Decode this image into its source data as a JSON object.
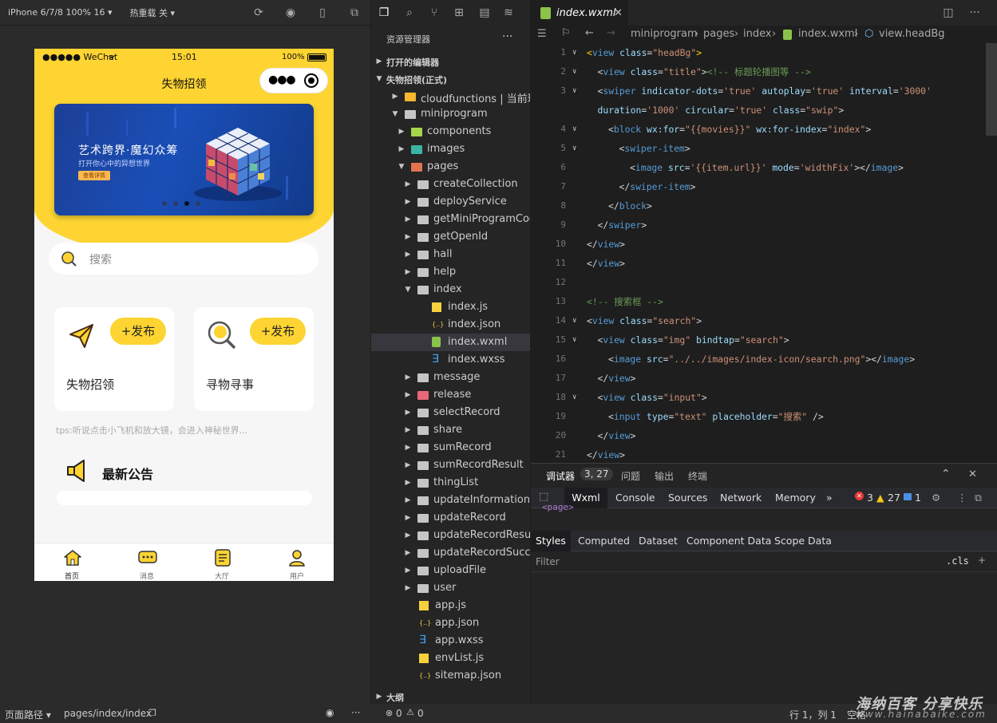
{
  "simulator": {
    "device_label": "iPhone 6/7/8 100% 16 ▾",
    "hot_reload_label": "热重载 关 ▾",
    "status": {
      "carrier": "●●●●● WeChat",
      "time": "15:01",
      "battery": "100%"
    },
    "nav_title": "失物招领",
    "banner": {
      "title": "艺术跨界·魔幻众筹",
      "subtitle": "打开你心中的异想世界",
      "button": "查看详情"
    },
    "search_placeholder": "搜索",
    "cards": [
      {
        "publish": "+发布",
        "label": "失物招领",
        "icon": "paper-plane-icon"
      },
      {
        "publish": "+发布",
        "label": "寻物寻事",
        "icon": "magnifier-icon"
      }
    ],
    "tips": "tps:听说点击小飞机和放大镜，会进入神秘世界...",
    "notice_title": "最新公告",
    "tabs": [
      {
        "label": "首页",
        "icon": "home-icon"
      },
      {
        "label": "消息",
        "icon": "message-icon"
      },
      {
        "label": "大厅",
        "icon": "hall-icon"
      },
      {
        "label": "用户",
        "icon": "user-icon"
      }
    ]
  },
  "explorer": {
    "header": "资源管理器",
    "sections": {
      "open_editors": "打开的编辑器",
      "project": "失物招领(正式)",
      "outline": "大纲"
    },
    "tree": [
      {
        "name": "cloudfunctions | 当前环境: ...",
        "depth": 1,
        "type": "folder-cloud",
        "open": false
      },
      {
        "name": "miniprogram",
        "depth": 1,
        "type": "folder",
        "open": true
      },
      {
        "name": "components",
        "depth": 2,
        "type": "folder-green",
        "open": false
      },
      {
        "name": "images",
        "depth": 2,
        "type": "folder-teal",
        "open": false
      },
      {
        "name": "pages",
        "depth": 2,
        "type": "folder-red",
        "open": true
      },
      {
        "name": "createCollection",
        "depth": 3,
        "type": "folder",
        "open": false
      },
      {
        "name": "deployService",
        "depth": 3,
        "type": "folder",
        "open": false
      },
      {
        "name": "getMiniProgramCode",
        "depth": 3,
        "type": "folder",
        "open": false
      },
      {
        "name": "getOpenId",
        "depth": 3,
        "type": "folder",
        "open": false
      },
      {
        "name": "hall",
        "depth": 3,
        "type": "folder",
        "open": false
      },
      {
        "name": "help",
        "depth": 3,
        "type": "folder",
        "open": false
      },
      {
        "name": "index",
        "depth": 3,
        "type": "folder",
        "open": true
      },
      {
        "name": "index.js",
        "depth": 4,
        "type": "js"
      },
      {
        "name": "index.json",
        "depth": 4,
        "type": "json"
      },
      {
        "name": "index.wxml",
        "depth": 4,
        "type": "wxml",
        "selected": true
      },
      {
        "name": "index.wxss",
        "depth": 4,
        "type": "wxss"
      },
      {
        "name": "message",
        "depth": 3,
        "type": "folder",
        "open": false
      },
      {
        "name": "release",
        "depth": 3,
        "type": "folder-pink",
        "open": false
      },
      {
        "name": "selectRecord",
        "depth": 3,
        "type": "folder",
        "open": false
      },
      {
        "name": "share",
        "depth": 3,
        "type": "folder",
        "open": false
      },
      {
        "name": "sumRecord",
        "depth": 3,
        "type": "folder",
        "open": false
      },
      {
        "name": "sumRecordResult",
        "depth": 3,
        "type": "folder",
        "open": false
      },
      {
        "name": "thingList",
        "depth": 3,
        "type": "folder",
        "open": false
      },
      {
        "name": "updateInformation",
        "depth": 3,
        "type": "folder",
        "open": false
      },
      {
        "name": "updateRecord",
        "depth": 3,
        "type": "folder",
        "open": false
      },
      {
        "name": "updateRecordResult",
        "depth": 3,
        "type": "folder",
        "open": false
      },
      {
        "name": "updateRecordSuccess",
        "depth": 3,
        "type": "folder",
        "open": false
      },
      {
        "name": "uploadFile",
        "depth": 3,
        "type": "folder",
        "open": false
      },
      {
        "name": "user",
        "depth": 3,
        "type": "folder",
        "open": false
      },
      {
        "name": "app.js",
        "depth": 2,
        "type": "js"
      },
      {
        "name": "app.json",
        "depth": 2,
        "type": "json"
      },
      {
        "name": "app.wxss",
        "depth": 2,
        "type": "wxss"
      },
      {
        "name": "envList.js",
        "depth": 2,
        "type": "js"
      },
      {
        "name": "sitemap.json",
        "depth": 2,
        "type": "json"
      }
    ]
  },
  "editor": {
    "tab": "index.wxml",
    "breadcrumb": [
      "miniprogram",
      "pages",
      "index",
      "index.wxml",
      "view.headBg"
    ],
    "lines": [
      {
        "n": "1",
        "fold": "∨",
        "indent": 0,
        "parts": [
          [
            "br",
            "<"
          ],
          [
            "tg",
            "view "
          ],
          [
            "at",
            "class"
          ],
          [
            "mu",
            "="
          ],
          [
            "st",
            "\"headBg\""
          ],
          [
            "br",
            ">"
          ]
        ]
      },
      {
        "n": "2",
        "fold": "∨",
        "indent": 1,
        "parts": [
          [
            "mu",
            "<"
          ],
          [
            "tg",
            "view "
          ],
          [
            "at",
            "class"
          ],
          [
            "mu",
            "="
          ],
          [
            "st",
            "\"title\""
          ],
          [
            "mu",
            ">"
          ],
          [
            "cm",
            "<!-- 标题轮播图等 -->"
          ]
        ]
      },
      {
        "n": "3",
        "fold": "∨",
        "indent": 1,
        "parts": [
          [
            "mu",
            "<"
          ],
          [
            "tg",
            "swiper "
          ],
          [
            "at",
            "indicator-dots"
          ],
          [
            "mu",
            "="
          ],
          [
            "st",
            "'true' "
          ],
          [
            "at",
            "autoplay"
          ],
          [
            "mu",
            "="
          ],
          [
            "st",
            "'true' "
          ],
          [
            "at",
            "interval"
          ],
          [
            "mu",
            "="
          ],
          [
            "st",
            "'3000'"
          ]
        ]
      },
      {
        "n": "",
        "fold": "",
        "indent": 1,
        "parts": [
          [
            "at",
            "duration"
          ],
          [
            "mu",
            "="
          ],
          [
            "st",
            "'1000' "
          ],
          [
            "at",
            "circular"
          ],
          [
            "mu",
            "="
          ],
          [
            "st",
            "'true' "
          ],
          [
            "at",
            "class"
          ],
          [
            "mu",
            "="
          ],
          [
            "st",
            "\"swip\""
          ],
          [
            "mu",
            ">"
          ]
        ]
      },
      {
        "n": "4",
        "fold": "∨",
        "indent": 2,
        "parts": [
          [
            "mu",
            "<"
          ],
          [
            "tg",
            "block "
          ],
          [
            "at",
            "wx:for"
          ],
          [
            "mu",
            "="
          ],
          [
            "st",
            "\"{{movies}}\" "
          ],
          [
            "at",
            "wx:for-index"
          ],
          [
            "mu",
            "="
          ],
          [
            "st",
            "\"index\""
          ],
          [
            "mu",
            ">"
          ]
        ]
      },
      {
        "n": "5",
        "fold": "∨",
        "indent": 3,
        "parts": [
          [
            "mu",
            "<"
          ],
          [
            "tg",
            "swiper-item"
          ],
          [
            "mu",
            ">"
          ]
        ]
      },
      {
        "n": "6",
        "fold": "",
        "indent": 4,
        "parts": [
          [
            "mu",
            "<"
          ],
          [
            "tg",
            "image "
          ],
          [
            "at",
            "src"
          ],
          [
            "mu",
            "="
          ],
          [
            "st",
            "'{{item.url}}' "
          ],
          [
            "at",
            "mode"
          ],
          [
            "mu",
            "="
          ],
          [
            "st",
            "'widthFix'"
          ],
          [
            "mu",
            "></"
          ],
          [
            "tg",
            "image"
          ],
          [
            "mu",
            ">"
          ]
        ]
      },
      {
        "n": "7",
        "fold": "",
        "indent": 3,
        "parts": [
          [
            "mu",
            "</"
          ],
          [
            "tg",
            "swiper-item"
          ],
          [
            "mu",
            ">"
          ]
        ]
      },
      {
        "n": "8",
        "fold": "",
        "indent": 2,
        "parts": [
          [
            "mu",
            "</"
          ],
          [
            "tg",
            "block"
          ],
          [
            "mu",
            ">"
          ]
        ]
      },
      {
        "n": "9",
        "fold": "",
        "indent": 1,
        "parts": [
          [
            "mu",
            "</"
          ],
          [
            "tg",
            "swiper"
          ],
          [
            "mu",
            ">"
          ]
        ]
      },
      {
        "n": "10",
        "fold": "",
        "indent": 0,
        "parts": [
          [
            "mu",
            "</"
          ],
          [
            "tg",
            "view"
          ],
          [
            "mu",
            ">"
          ]
        ]
      },
      {
        "n": "11",
        "fold": "",
        "indent": 0,
        "parts": [
          [
            "mu",
            "</"
          ],
          [
            "tg",
            "view"
          ],
          [
            "mu",
            ">"
          ]
        ]
      },
      {
        "n": "12",
        "fold": "",
        "indent": 0,
        "parts": []
      },
      {
        "n": "13",
        "fold": "",
        "indent": 0,
        "parts": [
          [
            "cm",
            "<!-- 搜索框 -->"
          ]
        ]
      },
      {
        "n": "14",
        "fold": "∨",
        "indent": 0,
        "parts": [
          [
            "mu",
            "<"
          ],
          [
            "tg",
            "view "
          ],
          [
            "at",
            "class"
          ],
          [
            "mu",
            "="
          ],
          [
            "st",
            "\"search\""
          ],
          [
            "mu",
            ">"
          ]
        ]
      },
      {
        "n": "15",
        "fold": "∨",
        "indent": 1,
        "parts": [
          [
            "mu",
            "<"
          ],
          [
            "tg",
            "view "
          ],
          [
            "at",
            "class"
          ],
          [
            "mu",
            "="
          ],
          [
            "st",
            "\"img\" "
          ],
          [
            "at",
            "bindtap"
          ],
          [
            "mu",
            "="
          ],
          [
            "st",
            "\"search\""
          ],
          [
            "mu",
            ">"
          ]
        ]
      },
      {
        "n": "16",
        "fold": "",
        "indent": 2,
        "parts": [
          [
            "mu",
            "<"
          ],
          [
            "tg",
            "image "
          ],
          [
            "at",
            "src"
          ],
          [
            "mu",
            "="
          ],
          [
            "st",
            "\"../../images/index-icon/search.png\""
          ],
          [
            "mu",
            "></"
          ],
          [
            "tg",
            "image"
          ],
          [
            "mu",
            ">"
          ]
        ]
      },
      {
        "n": "17",
        "fold": "",
        "indent": 1,
        "parts": [
          [
            "mu",
            "</"
          ],
          [
            "tg",
            "view"
          ],
          [
            "mu",
            ">"
          ]
        ]
      },
      {
        "n": "18",
        "fold": "∨",
        "indent": 1,
        "parts": [
          [
            "mu",
            "<"
          ],
          [
            "tg",
            "view "
          ],
          [
            "at",
            "class"
          ],
          [
            "mu",
            "="
          ],
          [
            "st",
            "\"input\""
          ],
          [
            "mu",
            ">"
          ]
        ]
      },
      {
        "n": "19",
        "fold": "",
        "indent": 2,
        "parts": [
          [
            "mu",
            "<"
          ],
          [
            "tg",
            "input "
          ],
          [
            "at",
            "type"
          ],
          [
            "mu",
            "="
          ],
          [
            "st",
            "\"text\" "
          ],
          [
            "at",
            "placeholder"
          ],
          [
            "mu",
            "="
          ],
          [
            "st",
            "\"搜索\" "
          ],
          [
            "mu",
            "/>"
          ]
        ]
      },
      {
        "n": "20",
        "fold": "",
        "indent": 1,
        "parts": [
          [
            "mu",
            "</"
          ],
          [
            "tg",
            "view"
          ],
          [
            "mu",
            ">"
          ]
        ]
      },
      {
        "n": "21",
        "fold": "",
        "indent": 0,
        "parts": [
          [
            "mu",
            "</"
          ],
          [
            "tg",
            "view"
          ],
          [
            "mu",
            ">"
          ]
        ]
      }
    ]
  },
  "debugger": {
    "title": "调试器",
    "badge": "3, 27",
    "tabs": [
      "问题",
      "输出",
      "终端"
    ],
    "devtools_tabs": [
      "Wxml",
      "Console",
      "Sources",
      "Network",
      "Memory"
    ],
    "more": "»",
    "errors": "3",
    "warnings": "27",
    "infos": "1",
    "page_node": "<page>",
    "style_tabs": [
      "Styles",
      "Computed",
      "Dataset",
      "Component Data",
      "Scope Data"
    ],
    "filter_placeholder": "Filter",
    "cls": ".cls",
    "plus": "+"
  },
  "status_bar": {
    "path_label": "页面路径 ▾",
    "path": "pages/index/index",
    "errors": "0",
    "warnings": "0",
    "cursor": "行 1，列 1",
    "space": "空格"
  },
  "watermark": {
    "main": "海纳百客 分享快乐",
    "sub": "www.hainabaike.com"
  },
  "colors": {
    "accent_yellow": "#fdd432",
    "editor_bg": "#1e1e1e",
    "sidebar_bg": "#252526"
  }
}
